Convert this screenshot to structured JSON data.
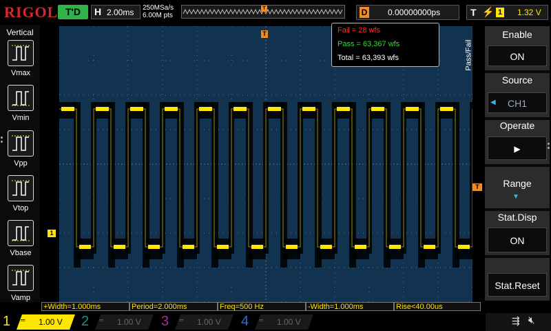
{
  "brand": "RIGOL",
  "run_state": "T'D",
  "timebase": {
    "key": "H",
    "value": "2.00ms"
  },
  "acquisition": {
    "sample_rate": "250MSa/s",
    "memory_depth": "6.00M pts"
  },
  "delay": {
    "key": "D",
    "value": "0.00000000ps"
  },
  "trigger": {
    "key": "T",
    "source": "1",
    "level": "1.32 V",
    "marker": "T"
  },
  "left_menu": {
    "title": "Vertical",
    "items": [
      {
        "label": "Vmax"
      },
      {
        "label": "Vmin"
      },
      {
        "label": "Vpp"
      },
      {
        "label": "Vtop"
      },
      {
        "label": "Vbase"
      },
      {
        "label": "Vamp"
      }
    ]
  },
  "channel_marker": "1",
  "pass_fail": {
    "fail": "Fail  =  28 wfs",
    "pass": "Pass =  63,367 wfs",
    "total": "Total  =  63,393 wfs"
  },
  "right_menu": {
    "tab_label": "Pass/Fail",
    "enable": {
      "label": "Enable",
      "value": "ON"
    },
    "source": {
      "label": "Source",
      "value": "CH1"
    },
    "operate": {
      "label": "Operate",
      "value": "▶"
    },
    "range": {
      "label": "Range"
    },
    "stat_disp": {
      "label": "Stat.Disp",
      "value": "ON"
    },
    "stat_reset": {
      "label": "Stat.Reset"
    }
  },
  "measurements": [
    "+Width=1.000ms",
    "Period=2.000ms",
    "Freq=500 Hz",
    "-Width=1.000ms",
    "Rise<40.00us"
  ],
  "channels": [
    {
      "num": "1",
      "value": "1.00 V",
      "color": "#ffe600",
      "active": true
    },
    {
      "num": "2",
      "value": "1.00 V",
      "color": "#1e8f8a",
      "active": false
    },
    {
      "num": "3",
      "value": "1.00 V",
      "color": "#a0308f",
      "active": false
    },
    {
      "num": "4",
      "value": "1.00 V",
      "color": "#2f6fd0",
      "active": false
    }
  ],
  "waveform": {
    "cycles": 12,
    "color": "#ffe600",
    "high_level_div": 1.6,
    "low_level_div": -2.4
  },
  "colors": {
    "grid_bg": "#113350",
    "trace": "#ffe600",
    "fail": "#ff3030",
    "pass": "#33dd33",
    "orange": "#f08a24"
  }
}
